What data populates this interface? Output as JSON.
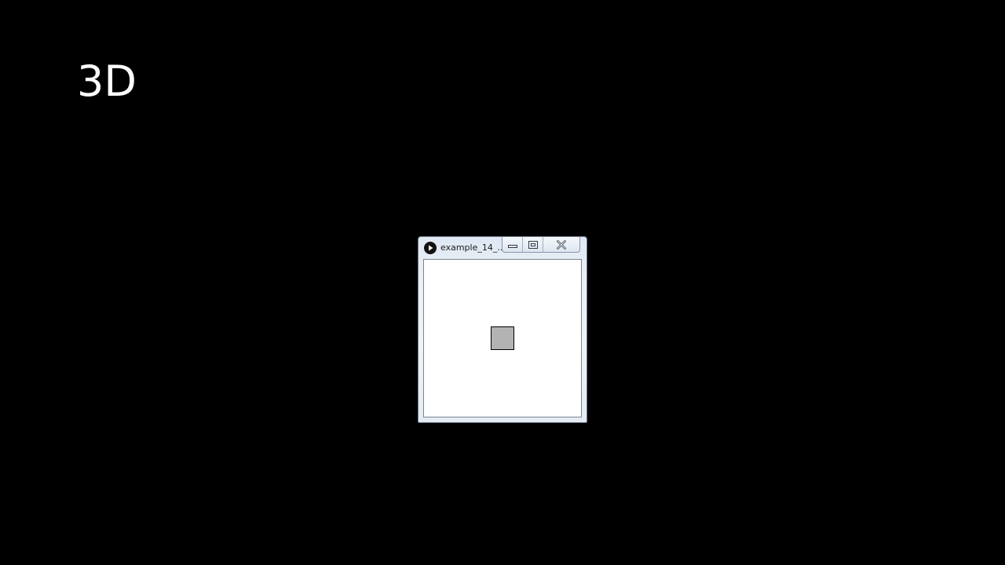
{
  "slide": {
    "title": "3D"
  },
  "window": {
    "title": "example_14_...",
    "app_icon": "play-icon",
    "buttons": {
      "minimize_icon": "minimize-icon",
      "maximize_icon": "maximize-icon",
      "close_icon": "close-icon"
    }
  },
  "sketch": {
    "background_color": "#ffffff",
    "box_fill_color": "#b3b3b3",
    "box_stroke_color": "#000000"
  },
  "colors": {
    "background": "#000000",
    "title_text": "#ffffff"
  }
}
